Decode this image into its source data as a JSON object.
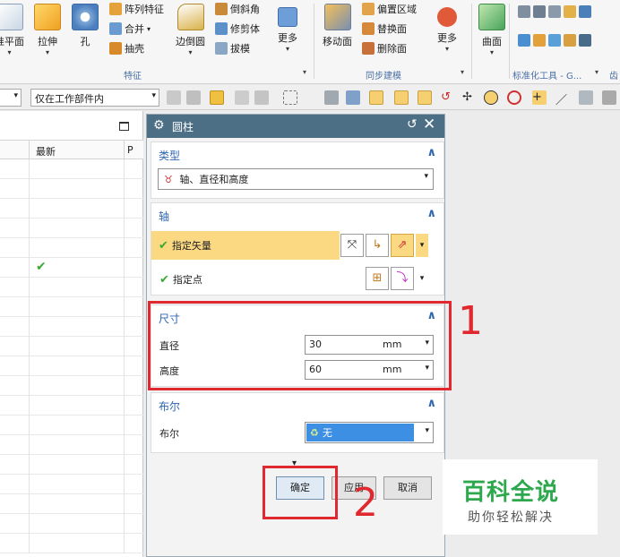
{
  "ribbon": {
    "left_cut_label": "准平面",
    "extrude_label": "拉伸",
    "hole_label": "孔",
    "small_col1": [
      "阵列特征",
      "合并",
      "抽壳"
    ],
    "edge_blend_label": "边倒圆",
    "small_col2": [
      "倒斜角",
      "修剪体",
      "拔模"
    ],
    "more1_label": "更多",
    "move_face_label": "移动面",
    "small_col3": [
      "偏置区域",
      "替换面",
      "删除面"
    ],
    "more2_label": "更多",
    "surface_label": "曲面",
    "group_feature": "特征",
    "group_sync": "同步建模",
    "group_std": "标准化工具 - G...",
    "group_cut": "齿"
  },
  "toolbar": {
    "scope_select": "仅在工作部件内"
  },
  "navigator": {
    "col_latest": "最新",
    "col_next": "P",
    "checked_row_index": 5,
    "row_count": 20
  },
  "dialog": {
    "title": "圆柱",
    "sections": {
      "type": {
        "header": "类型",
        "value": "轴、直径和高度"
      },
      "axis": {
        "header": "轴",
        "vector_label": "指定矢量",
        "point_label": "指定点"
      },
      "size": {
        "header": "尺寸",
        "diameter_label": "直径",
        "diameter_value": "30",
        "diameter_unit": "mm",
        "height_label": "高度",
        "height_value": "60",
        "height_unit": "mm"
      },
      "boolean": {
        "header": "布尔",
        "label": "布尔",
        "value": "无"
      }
    },
    "buttons": {
      "ok": "确定",
      "apply": "应用",
      "cancel": "取消"
    }
  },
  "annotations": {
    "num1": "1",
    "num2": "2"
  },
  "watermark": {
    "title": "百科全说",
    "subtitle": "助你轻松解决"
  },
  "colors": {
    "accent_blue": "#2f66b0",
    "title_bar": "#4d6f86",
    "highlight_yellow": "#fbd882",
    "red_annotation": "#e0282e",
    "check_green": "#3aaa35",
    "watermark_green": "#2da84c"
  }
}
